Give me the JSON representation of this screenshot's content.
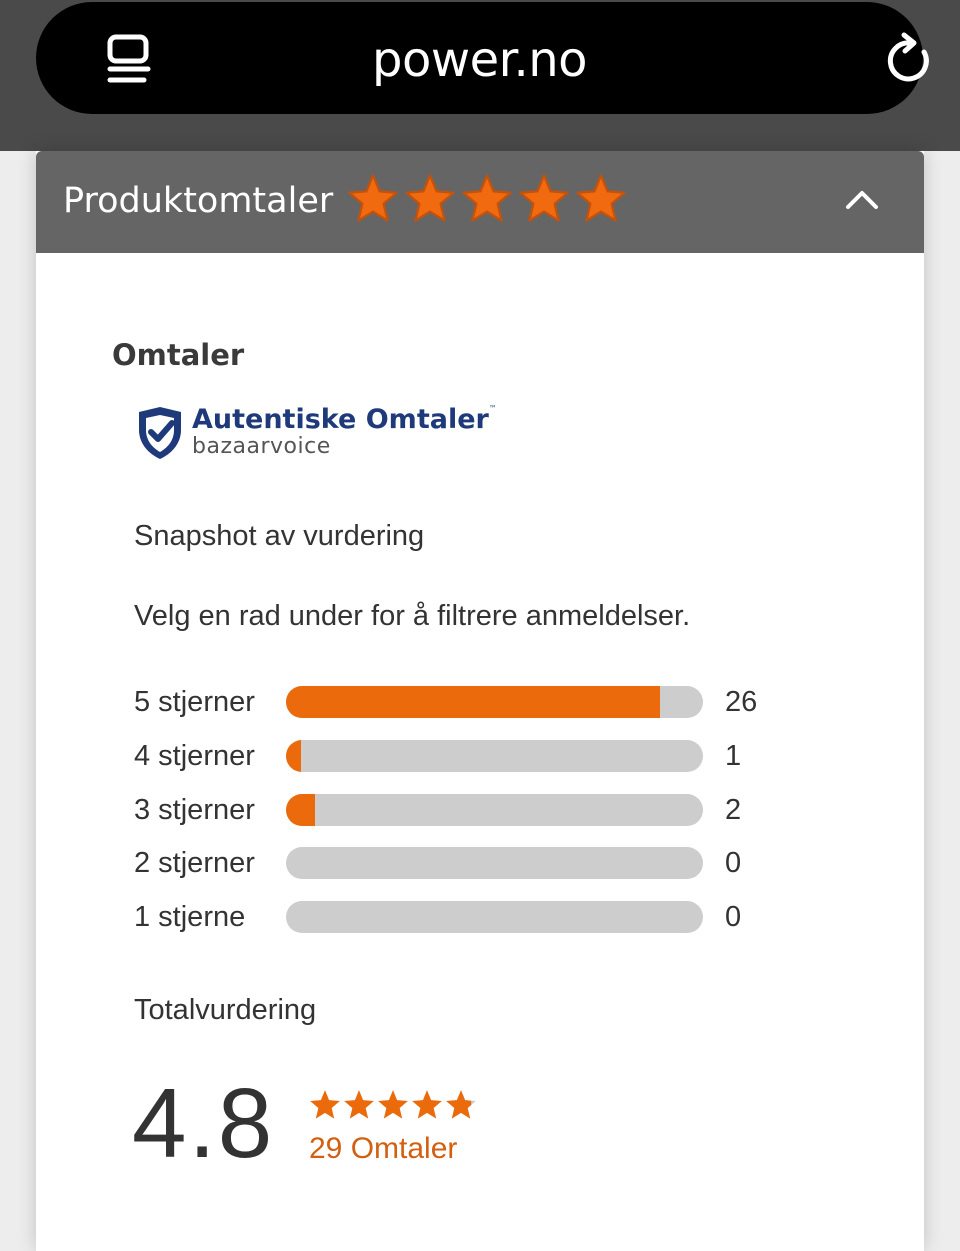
{
  "browser": {
    "url": "power.no",
    "tabs_icon": "tabs-icon",
    "reload_icon": "reload-icon"
  },
  "header": {
    "title": "Produktomtaler",
    "stars": 5,
    "star_color": "#f26a10",
    "collapse_icon": "chevron-up-icon"
  },
  "reviews": {
    "section_title": "Omtaler",
    "badge": {
      "title": "Autentiske Omtaler",
      "tm": "™",
      "subtitle": "bazaarvoice",
      "icon": "shield-check-icon"
    },
    "snapshot_title": "Snapshot av vurdering",
    "filter_hint": "Velg en rad under for å filtrere anmeldelser.",
    "rows": [
      {
        "label": "5 stjerner",
        "count": "26",
        "fraction": 0.897
      },
      {
        "label": "4 stjerner",
        "count": "1",
        "fraction": 0.035
      },
      {
        "label": "3 stjerner",
        "count": "2",
        "fraction": 0.069
      },
      {
        "label": "2 stjerner",
        "count": "0",
        "fraction": 0
      },
      {
        "label": "1 stjerne",
        "count": "0",
        "fraction": 0
      }
    ],
    "total_label": "Totalvurdering",
    "score": "4.8",
    "score_stars": 4.8,
    "review_count": "29 Omtaler"
  },
  "colors": {
    "accent": "#ea6a0c",
    "track": "#cdcdcd",
    "header_bg": "#656565",
    "badge_blue": "#1f3a7a"
  }
}
